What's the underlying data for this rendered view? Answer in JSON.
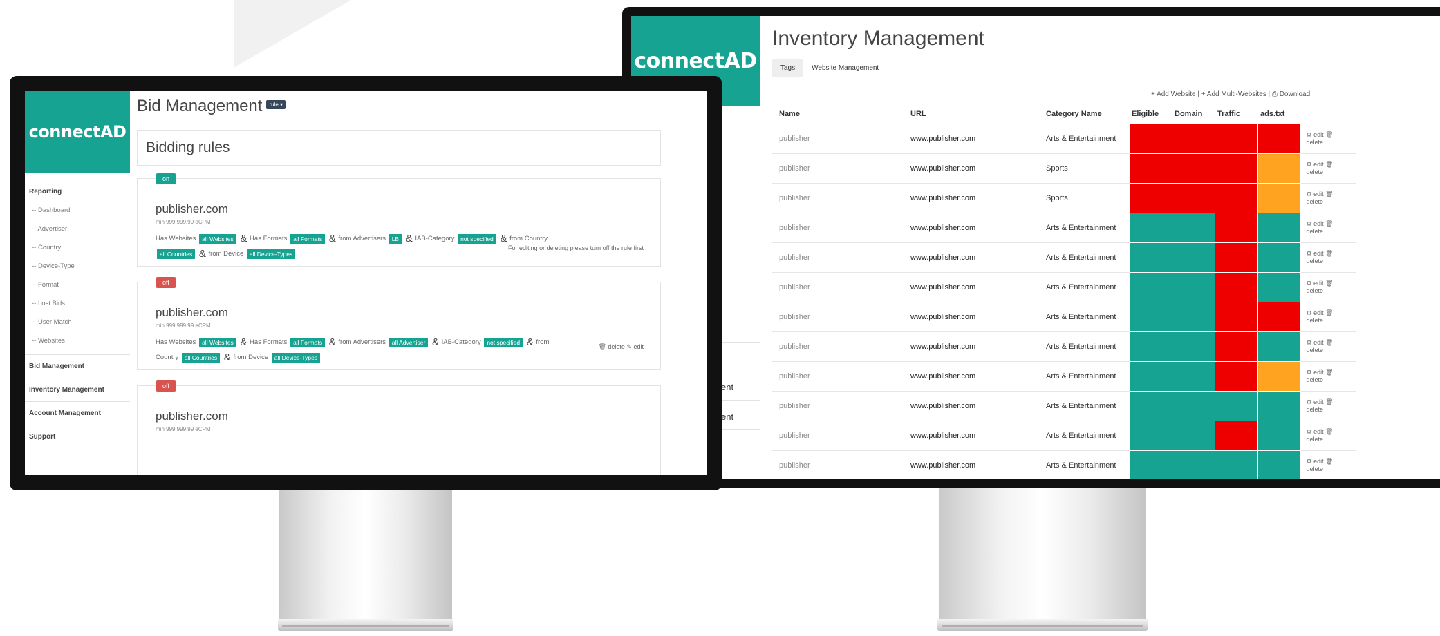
{
  "right_app": {
    "logo": "connectAD",
    "title": "Inventory Management",
    "tabs": [
      "Tags",
      "Website Management"
    ],
    "actions": "+ Add Website | + Add Multi-Websites | ⎙ Download",
    "side_fragments": [
      "ent",
      "ent"
    ],
    "columns": [
      "Name",
      "URL",
      "Category Name",
      "Eligible",
      "Domain",
      "Traffic",
      "ads.txt"
    ],
    "rows": [
      {
        "name": "publisher",
        "url": "www.publisher.com",
        "category": "Arts & Entertainment",
        "cells": [
          "red",
          "red",
          "red",
          "red"
        ]
      },
      {
        "name": "publisher",
        "url": "www.publisher.com",
        "category": "Sports",
        "cells": [
          "red",
          "red",
          "red",
          "orange"
        ]
      },
      {
        "name": "publisher",
        "url": "www.publisher.com",
        "category": "Sports",
        "cells": [
          "red",
          "red",
          "red",
          "orange"
        ]
      },
      {
        "name": "publisher",
        "url": "www.publisher.com",
        "category": "Arts & Entertainment",
        "cells": [
          "teal",
          "teal",
          "red",
          "teal"
        ]
      },
      {
        "name": "publisher",
        "url": "www.publisher.com",
        "category": "Arts & Entertainment",
        "cells": [
          "teal",
          "teal",
          "red",
          "teal"
        ]
      },
      {
        "name": "publisher",
        "url": "www.publisher.com",
        "category": "Arts & Entertainment",
        "cells": [
          "teal",
          "teal",
          "red",
          "teal"
        ]
      },
      {
        "name": "publisher",
        "url": "www.publisher.com",
        "category": "Arts & Entertainment",
        "cells": [
          "teal",
          "teal",
          "red",
          "red"
        ]
      },
      {
        "name": "publisher",
        "url": "www.publisher.com",
        "category": "Arts & Entertainment",
        "cells": [
          "teal",
          "teal",
          "red",
          "teal"
        ]
      },
      {
        "name": "publisher",
        "url": "www.publisher.com",
        "category": "Arts & Entertainment",
        "cells": [
          "teal",
          "teal",
          "red",
          "orange"
        ]
      },
      {
        "name": "publisher",
        "url": "www.publisher.com",
        "category": "Arts & Entertainment",
        "cells": [
          "teal",
          "teal",
          "teal",
          "teal"
        ]
      },
      {
        "name": "publisher",
        "url": "www.publisher.com",
        "category": "Arts & Entertainment",
        "cells": [
          "teal",
          "teal",
          "red",
          "teal"
        ]
      },
      {
        "name": "publisher",
        "url": "www.publisher.com",
        "category": "Arts & Entertainment",
        "cells": [
          "teal",
          "teal",
          "teal",
          "teal"
        ]
      }
    ],
    "row_action_edit": "⚙ edit 🗑",
    "row_action_delete": "delete"
  },
  "left_app": {
    "logo": "connectAD",
    "title": "Bid Management",
    "title_badge": "rule ▾",
    "header": "Bidding rules",
    "nav": {
      "reporting": "Reporting",
      "reporting_items": [
        "-- Dashboard",
        "-- Advertiser",
        "-- Country",
        "-- Device-Type",
        "-- Format",
        "-- Lost Bids",
        "-- User Match",
        "-- Websites"
      ],
      "sections": [
        "Bid Management",
        "Inventory Management",
        "Account Management",
        "Support"
      ]
    },
    "rules": [
      {
        "status": "on",
        "publisher": "publisher.com",
        "cpm": "min 999,999.99 eCPM",
        "line1": {
          "t1": "Has Websites",
          "tag1": "all Websites",
          "t2": "Has Formats",
          "tag2": "all Formats",
          "t3": "from Advertisers",
          "tag3": "LB",
          "t4": "IAB-Category",
          "tag4": "not specified",
          "t5": "from Country"
        },
        "line2": {
          "tag1": "all Countries",
          "t1": "from Device",
          "tag2": "all Device-Types"
        },
        "note": "For editing or deleting please turn off the rule first"
      },
      {
        "status": "off",
        "publisher": "publisher.com",
        "cpm": "min 999,999.99 eCPM",
        "line1": {
          "t1": "Has Websites",
          "tag1": "all Websites",
          "t2": "Has Formats",
          "tag2": "all Formats",
          "t3": "from Advertisers",
          "tag3": "all Advertiser",
          "t4": "IAB-Category",
          "tag4": "not specified",
          "t5": "from"
        },
        "line2": {
          "t0": "Country",
          "tag1": "all Countries",
          "t1": "from Device",
          "tag2": "all Device-Types"
        },
        "note": "🗑 delete ✎ edit"
      },
      {
        "status": "off",
        "publisher": "publisher.com",
        "cpm": "min 999,999.99 eCPM"
      }
    ],
    "amp": "&"
  }
}
